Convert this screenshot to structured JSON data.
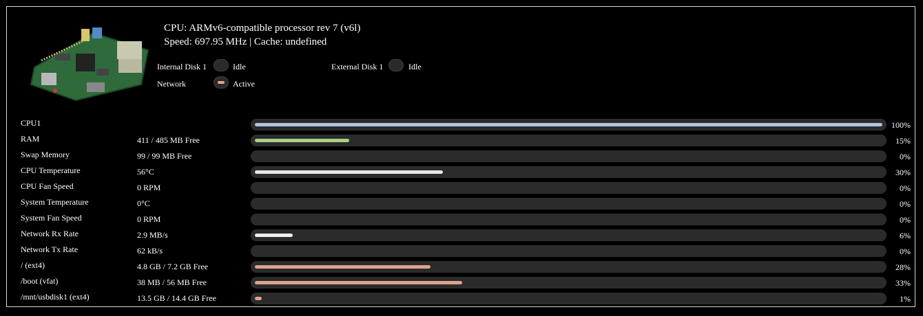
{
  "header": {
    "cpu_line": "CPU: ARMv6-compatible processor rev 7 (v6l)",
    "speed_line": "Speed: 697.95 MHz | Cache: undefined"
  },
  "indicators": [
    {
      "label": "Internal Disk 1",
      "state": "Idle",
      "active": false
    },
    {
      "label": "External Disk 1",
      "state": "Idle",
      "active": false
    },
    {
      "label": "Network",
      "state": "Active",
      "active": true
    }
  ],
  "colors": {
    "cpu": "#a9c6df",
    "ram": "#a8d08a",
    "temp": "#e8e8e8",
    "net": "#f0f0f0",
    "disk": "#dca48a",
    "led_active": "#e3a88a"
  },
  "stats": [
    {
      "label": "CPU1",
      "value": "",
      "percent": 100,
      "percent_text": "100%",
      "color_key": "cpu"
    },
    {
      "label": "RAM",
      "value": "411 / 485 MB Free",
      "percent": 15,
      "percent_text": "15%",
      "color_key": "ram"
    },
    {
      "label": "Swap Memory",
      "value": "99 / 99 MB Free",
      "percent": 0,
      "percent_text": "0%",
      "color_key": "temp"
    },
    {
      "label": "CPU Temperature",
      "value": "56°C",
      "percent": 30,
      "percent_text": "30%",
      "color_key": "temp"
    },
    {
      "label": "CPU Fan Speed",
      "value": "0 RPM",
      "percent": 0,
      "percent_text": "0%",
      "color_key": "temp"
    },
    {
      "label": "System Temperature",
      "value": "0°C",
      "percent": 0,
      "percent_text": "0%",
      "color_key": "temp"
    },
    {
      "label": "System Fan Speed",
      "value": "0 RPM",
      "percent": 0,
      "percent_text": "0%",
      "color_key": "temp"
    },
    {
      "label": "Network Rx Rate",
      "value": "2.9 MB/s",
      "percent": 6,
      "percent_text": "6%",
      "color_key": "net"
    },
    {
      "label": "Network Tx Rate",
      "value": "62 kB/s",
      "percent": 0,
      "percent_text": "0%",
      "color_key": "net"
    },
    {
      "label": "/ (ext4)",
      "value": "4.8 GB / 7.2 GB Free",
      "percent": 28,
      "percent_text": "28%",
      "color_key": "disk"
    },
    {
      "label": "/boot (vfat)",
      "value": "38 MB / 56 MB Free",
      "percent": 33,
      "percent_text": "33%",
      "color_key": "disk"
    },
    {
      "label": "/mnt/usbdisk1 (ext4)",
      "value": "13.5 GB / 14.4 GB Free",
      "percent": 1,
      "percent_text": "1%",
      "color_key": "disk"
    }
  ]
}
